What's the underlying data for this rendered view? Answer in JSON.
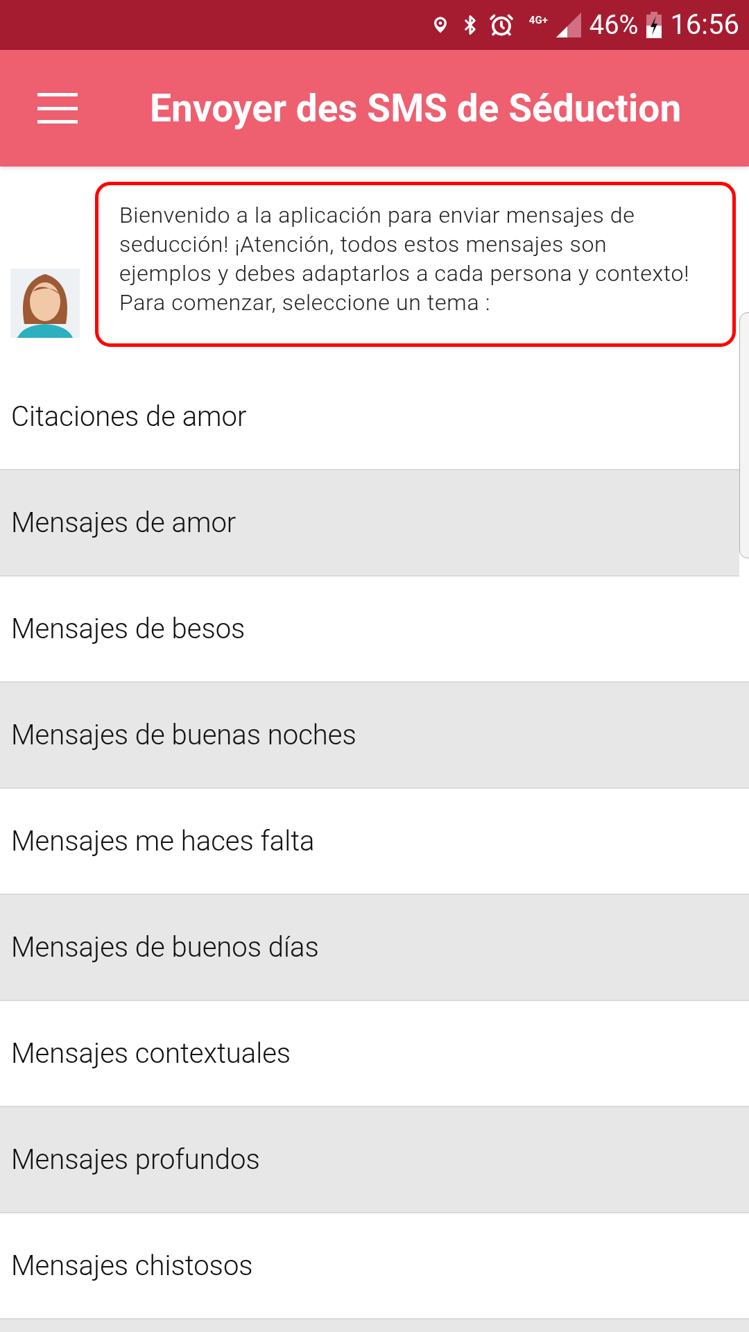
{
  "status_bar": {
    "network": "4G+",
    "battery": "46%",
    "time": "16:56"
  },
  "app_bar": {
    "title": "Envoyer des SMS de Séduction"
  },
  "welcome": {
    "message": "Bienvenido a la aplicación para enviar mensajes de seducción! ¡Atención, todos estos mensajes son ejemplos y debes adaptarlos a cada persona y contexto! Para comenzar, seleccione un tema :"
  },
  "topics": [
    {
      "label": "Citaciones de amor"
    },
    {
      "label": "Mensajes de amor"
    },
    {
      "label": "Mensajes de besos"
    },
    {
      "label": "Mensajes de buenas noches"
    },
    {
      "label": "Mensajes me haces falta"
    },
    {
      "label": "Mensajes de buenos días"
    },
    {
      "label": "Mensajes contextuales"
    },
    {
      "label": "Mensajes profundos"
    },
    {
      "label": "Mensajes chistosos"
    }
  ]
}
